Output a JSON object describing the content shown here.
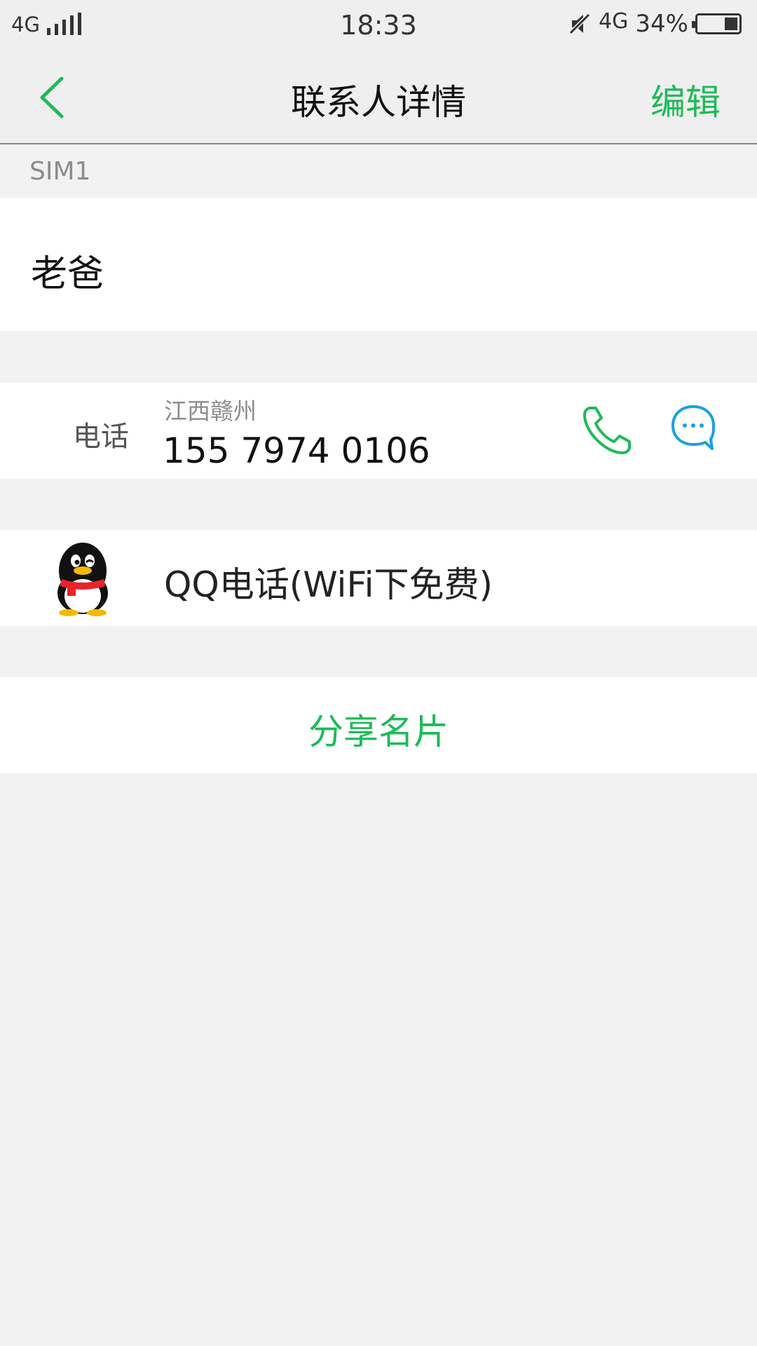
{
  "status_bar": {
    "network_left": "4G",
    "time": "18:33",
    "network_right": "4G",
    "battery": "34%",
    "battery_level": 0.34
  },
  "nav": {
    "title": "联系人详情",
    "edit_label": "编辑",
    "back_icon": "chevron-left-icon"
  },
  "contact": {
    "sim_label": "SIM1",
    "name": "老爸"
  },
  "phone": {
    "label": "电话",
    "location": "江西赣州",
    "number": "155 7974 0106",
    "call_icon": "phone-icon",
    "message_icon": "message-bubble-icon"
  },
  "qq": {
    "label": "QQ电话(WiFi下免费)",
    "icon": "qq-penguin-icon"
  },
  "share": {
    "label": "分享名片"
  },
  "colors": {
    "accent_green": "#1fba58",
    "message_blue": "#1a9fe0",
    "background": "#f2f2f2"
  }
}
